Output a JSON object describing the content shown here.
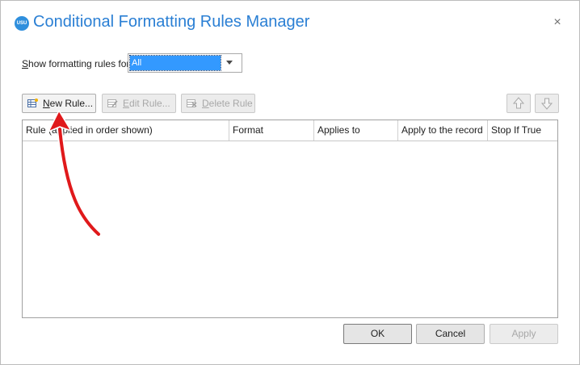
{
  "dialog": {
    "title": "Conditional Formatting Rules Manager",
    "app_icon_text": "USU",
    "close_glyph": "×"
  },
  "filter": {
    "label_prefix": "S",
    "label_rest": "how formatting rules for:",
    "selected_value": "All"
  },
  "toolbar": {
    "new_rule": {
      "mnemonic": "N",
      "rest": "ew Rule...",
      "icon": "table-new-icon"
    },
    "edit_rule": {
      "mnemonic": "E",
      "rest": "dit Rule...",
      "icon": "table-edit-icon"
    },
    "delete_rule": {
      "mnemonic": "D",
      "rest": "elete Rule",
      "icon": "table-delete-icon"
    },
    "move_up_icon": "arrow-up-icon",
    "move_down_icon": "arrow-down-icon"
  },
  "grid": {
    "columns": [
      "Rule (applied in order shown)",
      "Format",
      "Applies to",
      "Apply to the record",
      "Stop If True"
    ],
    "rows": []
  },
  "footer": {
    "ok": "OK",
    "cancel": "Cancel",
    "apply": "Apply"
  },
  "colors": {
    "title": "#2a7fd4",
    "selection": "#3399ff",
    "annotation_arrow": "#e0191b"
  }
}
